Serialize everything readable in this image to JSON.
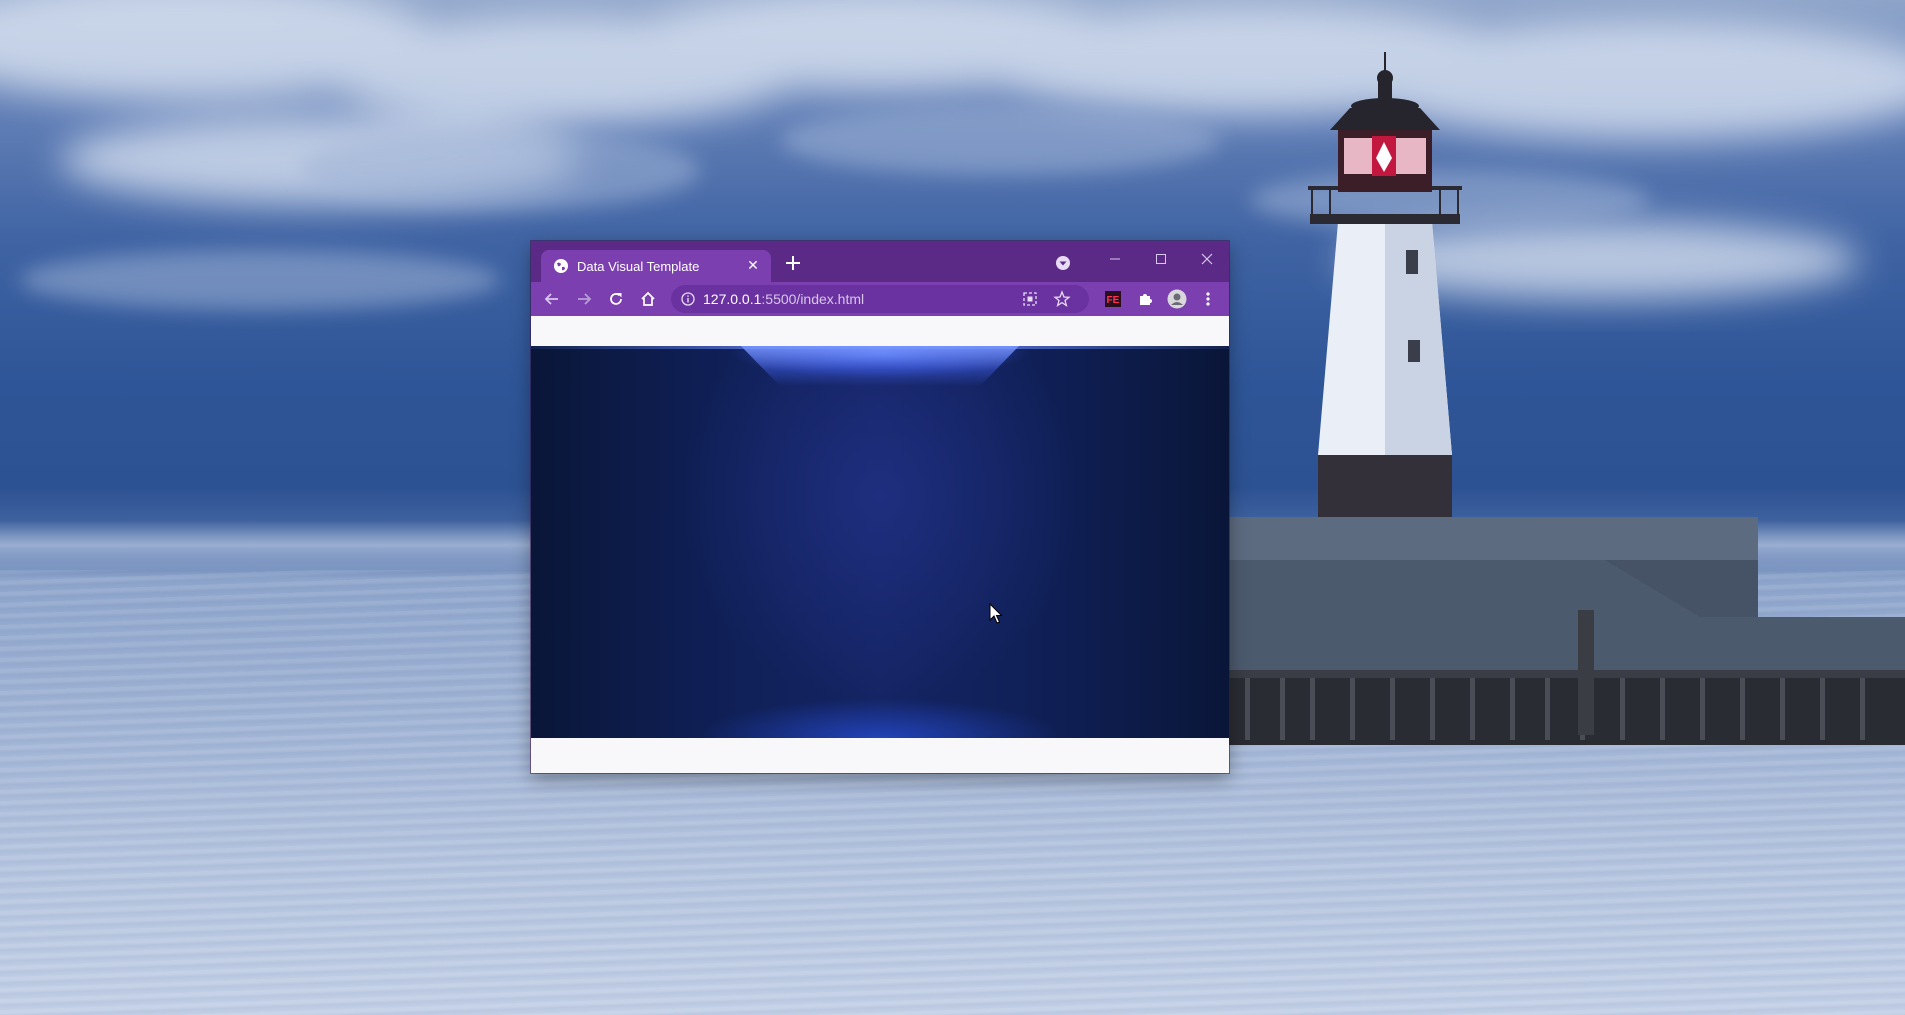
{
  "browser": {
    "tab": {
      "title": "Data Visual Template",
      "close_label": "✕"
    },
    "address": {
      "host": "127.0.0.1",
      "rest": ":5500/index.html"
    }
  },
  "icons": {
    "tab_favicon": "globe-icon",
    "new_tab": "plus-icon",
    "tab_search": "chevron-down-circle-icon",
    "back": "arrow-left-icon",
    "forward": "arrow-right-icon",
    "reload": "reload-icon",
    "home": "home-icon",
    "site_info": "info-icon",
    "install_app": "install-icon",
    "bookmark": "star-icon",
    "extension_fe": "fe-extension-icon",
    "extensions": "puzzle-icon",
    "profile": "profile-avatar-icon",
    "menu": "kebab-menu-icon"
  },
  "colors": {
    "titlebar": "#5b2a86",
    "toolbar": "#7b3fb0",
    "page_background": "#0b1a45",
    "page_glow": "#5c82ff"
  }
}
